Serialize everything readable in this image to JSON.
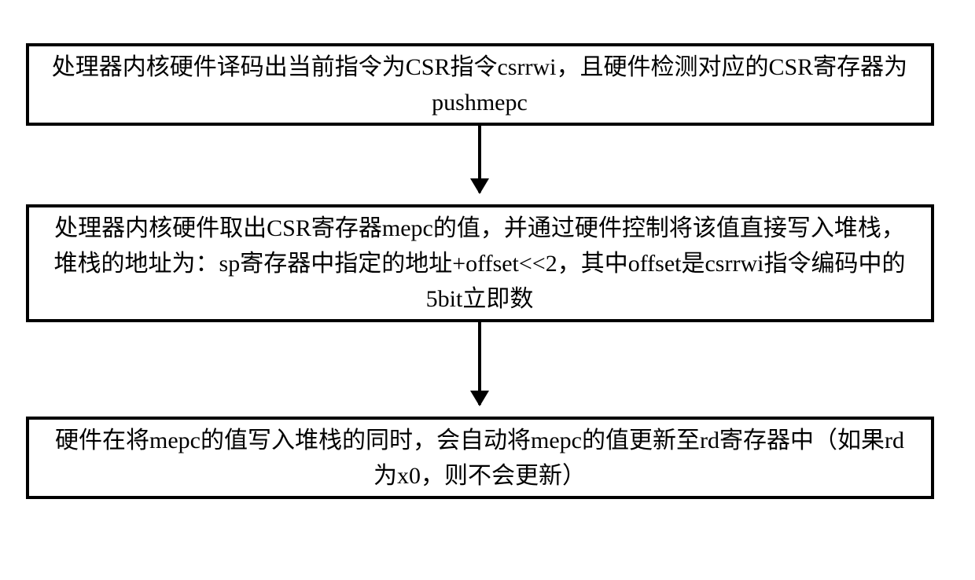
{
  "flowchart": {
    "box1": {
      "text": "处理器内核硬件译码出当前指令为CSR指令csrrwi，且硬件检测对应的CSR寄存器为pushmepc"
    },
    "box2": {
      "text": "处理器内核硬件取出CSR寄存器mepc的值，并通过硬件控制将该值直接写入堆栈，堆栈的地址为：sp寄存器中指定的地址+offset<<2，其中offset是csrrwi指令编码中的5bit立即数"
    },
    "box3": {
      "text": "硬件在将mepc的值写入堆栈的同时，会自动将mepc的值更新至rd寄存器中（如果rd为x0，则不会更新）"
    }
  }
}
